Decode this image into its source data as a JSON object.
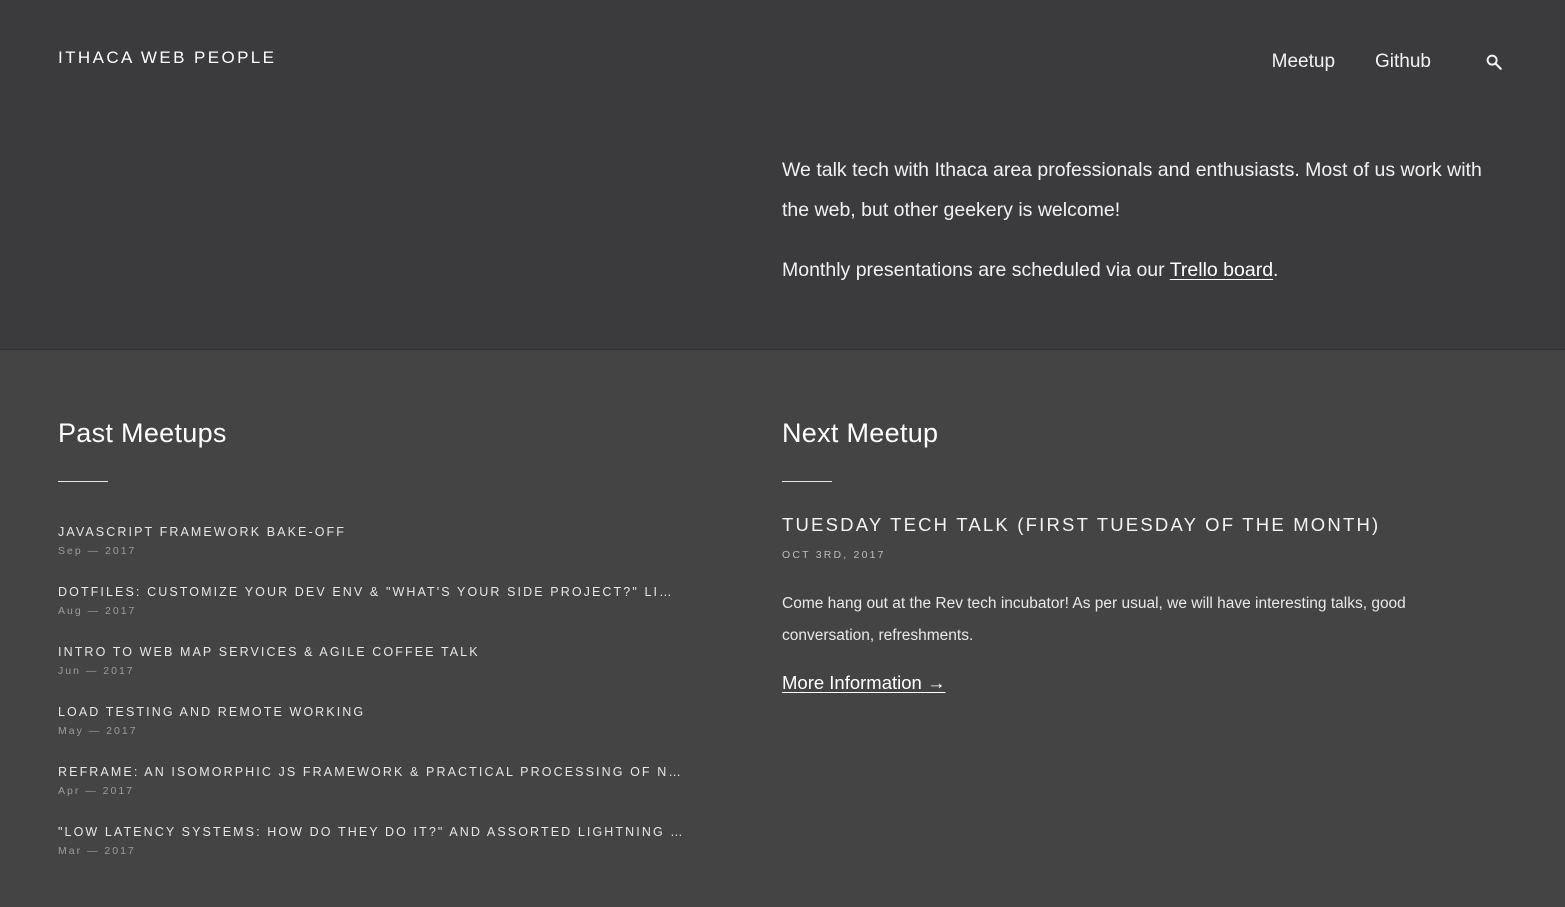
{
  "header": {
    "site_title": "ITHACA WEB PEOPLE",
    "nav": [
      {
        "label": "Meetup"
      },
      {
        "label": "Github"
      }
    ],
    "search_icon": "search-icon"
  },
  "intro": {
    "paragraph1": "We talk tech with Ithaca area professionals and enthusiasts. Most of us work with the web, but other geekery is welcome!",
    "paragraph2_prefix": "Monthly presentations are scheduled via our ",
    "paragraph2_link": "Trello board",
    "paragraph2_suffix": "."
  },
  "past_meetups": {
    "heading": "Past Meetups",
    "items": [
      {
        "title": "JAVASCRIPT FRAMEWORK BAKE-OFF",
        "date": "Sep — 2017"
      },
      {
        "title": "DOTFILES: CUSTOMIZE YOUR DEV ENV & \"WHAT'S YOUR SIDE PROJECT?\" LIGHTNING …",
        "date": "Aug — 2017"
      },
      {
        "title": "INTRO TO WEB MAP SERVICES & AGILE COFFEE TALK",
        "date": "Jun — 2017"
      },
      {
        "title": "LOAD TESTING AND REMOTE WORKING",
        "date": "May — 2017"
      },
      {
        "title": "REFRAME: AN ISOMORPHIC JS FRAMEWORK & PRACTICAL PROCESSING OF NATURAL …",
        "date": "Apr — 2017"
      },
      {
        "title": "\"LOW LATENCY SYSTEMS: HOW DO THEY DO IT?\" AND ASSORTED LIGHTNING TALKS",
        "date": "Mar — 2017"
      }
    ]
  },
  "next_meetup": {
    "heading": "Next Meetup",
    "title": "TUESDAY TECH TALK (FIRST TUESDAY OF THE MONTH)",
    "date": "OCT 3RD, 2017",
    "description": "Come hang out at the Rev tech incubator! As per usual, we will have interesting talks, good conversation, refreshments.",
    "more_link": "More Information →"
  }
}
